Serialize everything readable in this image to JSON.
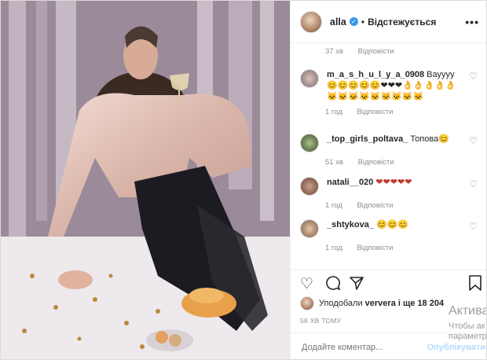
{
  "header": {
    "username": "alla",
    "verified_icon": "verified-badge-icon",
    "dot": "•",
    "follow_status": "Відстежується",
    "more_icon": "more-options-icon"
  },
  "comments": [
    {
      "time": "37 хв",
      "reply": "Відповісти"
    },
    {
      "user": "m_a_s_h_u_l_y_a_0908",
      "text": "Вауууу😊😊😊😊😊❤❤❤👌👌👌👌👌🐱🐱🐱🐱🐱🐱🐱🐱🐱",
      "time": "1 год",
      "reply": "Відповісти"
    },
    {
      "user": "_top_girls_poltava_",
      "text": "Топова😊",
      "time": "51 хв",
      "reply": "Відповісти"
    },
    {
      "user": "natali__020",
      "text": "❤❤❤❤❤",
      "time": "1 год",
      "reply": "Відповісти"
    },
    {
      "user": "_shtykova_",
      "text": "😊😊😊",
      "time": "1 год",
      "reply": "Відповісти"
    }
  ],
  "likes": {
    "text": "Уподобали",
    "user": "ververa",
    "rest": "і ще 18 204"
  },
  "time_ago": "58 ХВ ТОМУ",
  "add_comment": {
    "placeholder": "Додайте коментар...",
    "post_label": "Опублікувати"
  },
  "watermark": {
    "line1": "Актива",
    "line2": "Чтобы ак",
    "line3": "параметр"
  }
}
